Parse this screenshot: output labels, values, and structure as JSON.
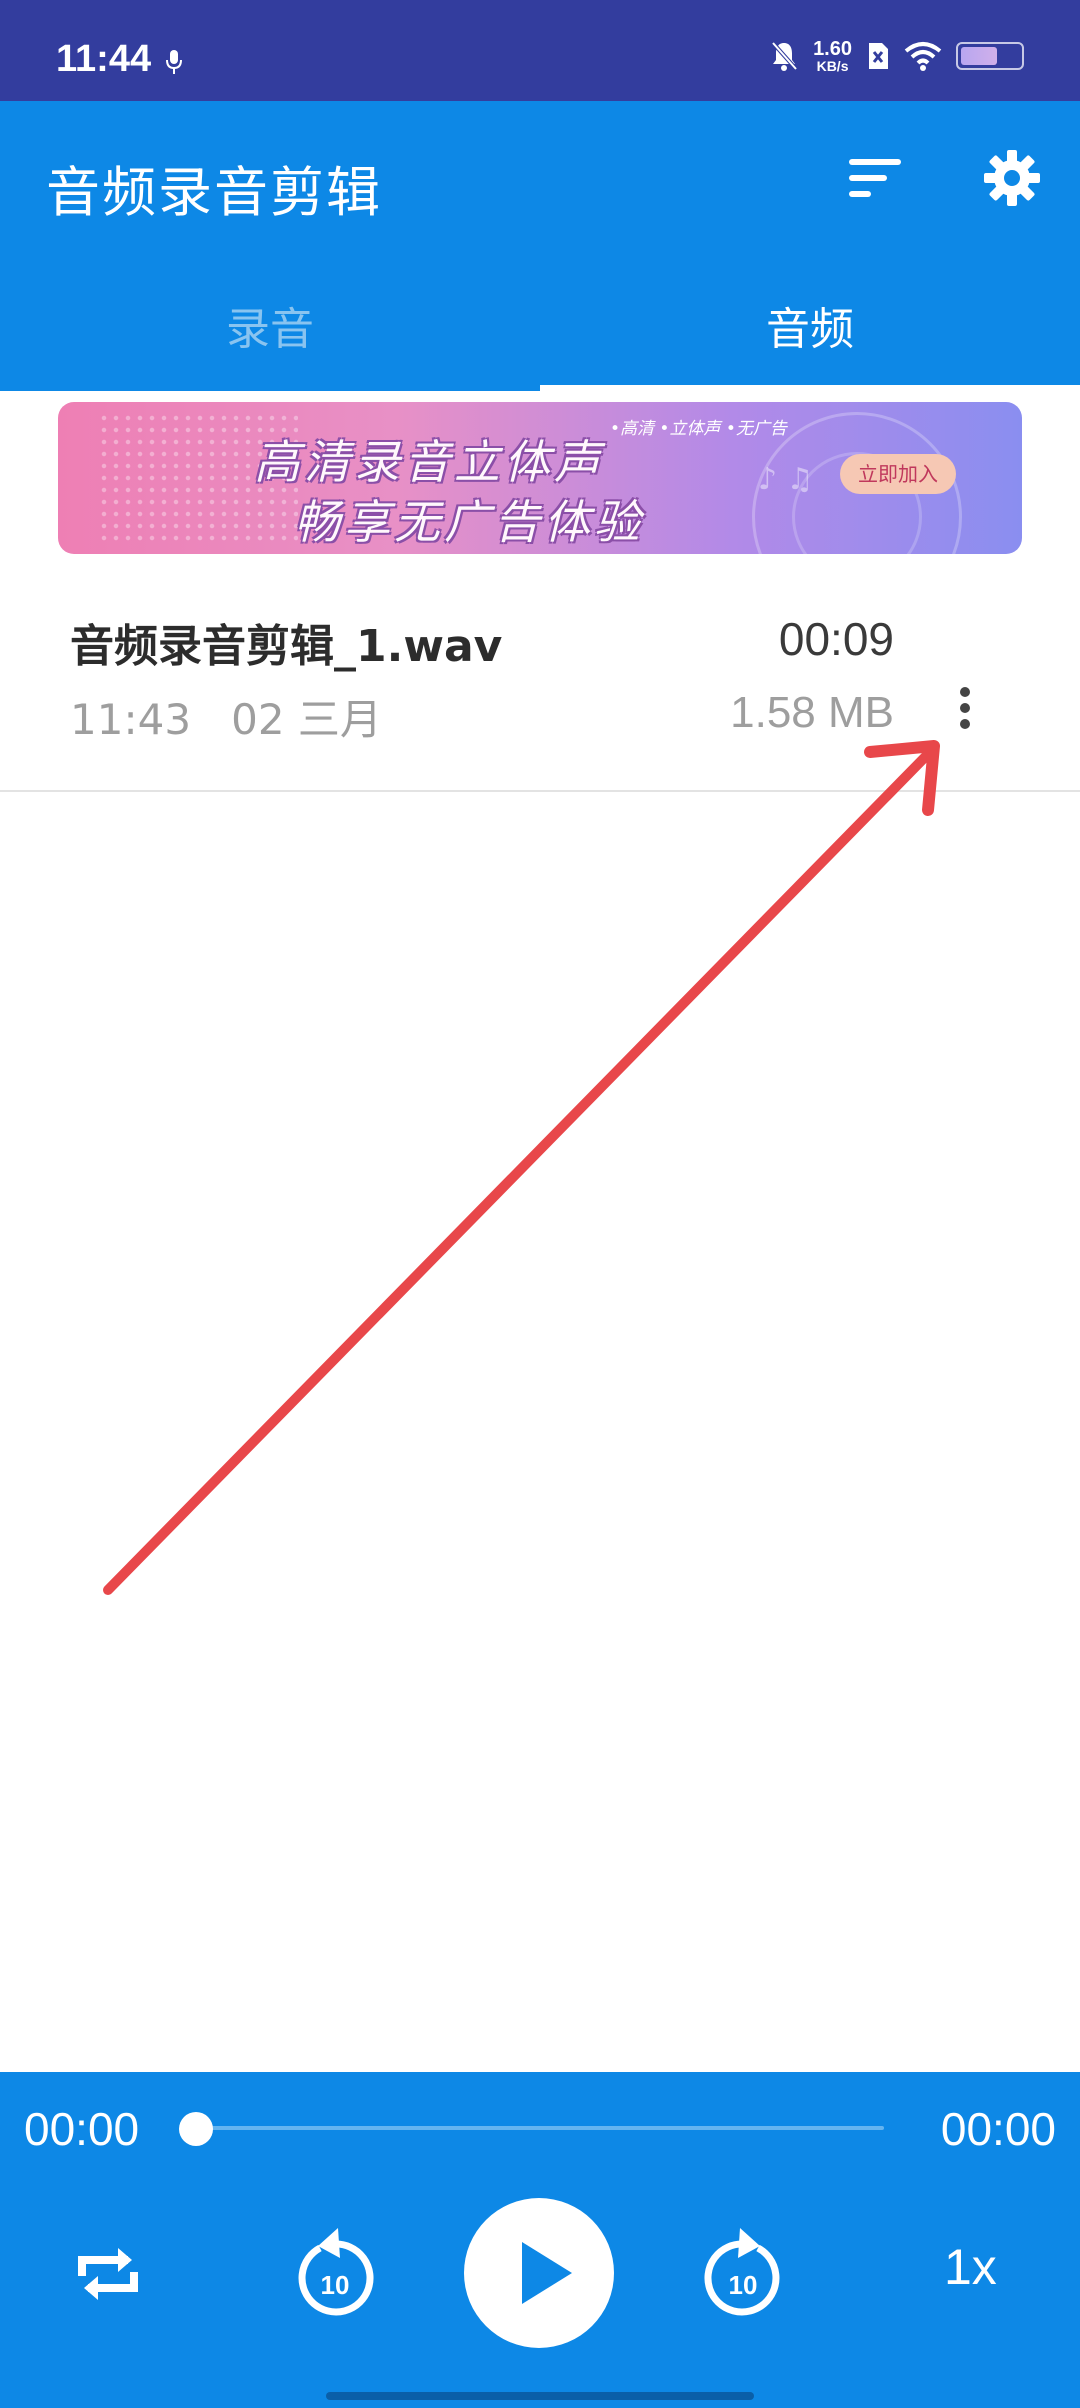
{
  "status_bar": {
    "time": "11:44",
    "net_speed_value": "1.60",
    "net_speed_unit": "KB/s",
    "icons": [
      "mic-icon",
      "mute-bell-icon",
      "sim-icon",
      "wifi-icon",
      "battery-icon"
    ]
  },
  "app_bar": {
    "title": "音频录音剪辑",
    "actions": [
      "sort-icon",
      "settings-icon"
    ],
    "tabs": [
      {
        "label": "录音",
        "selected": false
      },
      {
        "label": "音频",
        "selected": true
      }
    ]
  },
  "banner": {
    "line1": "高清录音立体声",
    "line2": "畅享无广告体验",
    "tags": "•高清 •立体声 •无广告",
    "button_label": "立即加入"
  },
  "files": [
    {
      "name": "音频录音剪辑_1.wav",
      "duration": "00:09",
      "time": "11:43",
      "date": "02 三月",
      "size": "1.58 MB"
    }
  ],
  "player": {
    "current_time": "00:00",
    "total_time": "00:00",
    "progress": 0,
    "rewind_seconds": "10",
    "forward_seconds": "10",
    "speed": "1x"
  },
  "colors": {
    "status_bar": "#333d9e",
    "primary": "#0d88e6",
    "annotation_arrow": "#e8474a"
  }
}
